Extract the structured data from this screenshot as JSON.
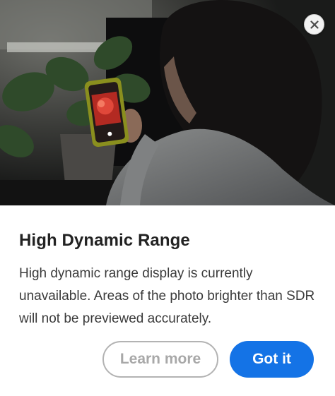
{
  "dialog": {
    "title": "High Dynamic Range",
    "body": "High dynamic range display is currently unavailable. Areas of the photo brighter than SDR will not be previewed accurately.",
    "secondary_button_label": "Learn more",
    "primary_button_label": "Got it",
    "close_icon": "close-icon",
    "hero_image": "person-holding-phone-photo"
  },
  "colors": {
    "primary": "#1473e6",
    "secondary_border": "#b3b3b3",
    "title": "#222222",
    "body": "#3a3a3a"
  }
}
